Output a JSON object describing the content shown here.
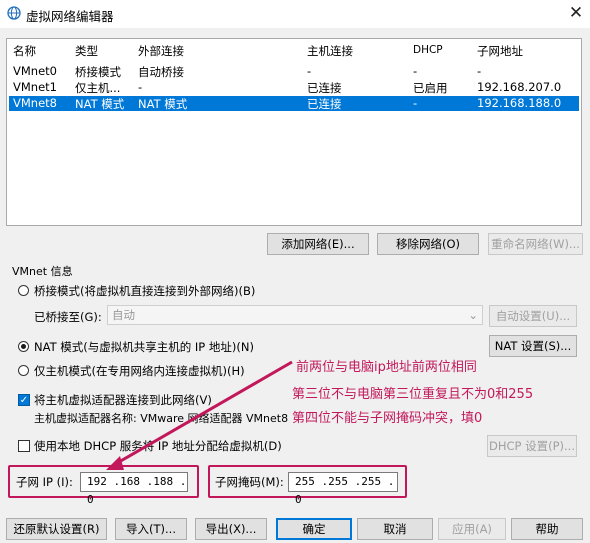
{
  "window": {
    "title": "虚拟网络编辑器",
    "icon": "network-globe-icon",
    "close_icon": "close-icon"
  },
  "table": {
    "headers": [
      "名称",
      "类型",
      "外部连接",
      "主机连接",
      "DHCP",
      "子网地址"
    ],
    "rows": [
      [
        "VMnet0",
        "桥接模式",
        "自动桥接",
        "-",
        "-",
        "-"
      ],
      [
        "VMnet1",
        "仅主机...",
        "-",
        "已连接",
        "已启用",
        "192.168.207.0"
      ],
      [
        "VMnet8",
        "NAT 模式",
        "NAT 模式",
        "已连接",
        "-",
        "192.168.188.0"
      ]
    ],
    "selected_row": 2
  },
  "table_buttons": {
    "add": "添加网络(E)...",
    "remove": "移除网络(O)",
    "rename": "重命名网络(W)..."
  },
  "vmnet_info": {
    "group_label": "VMnet 信息",
    "bridged_radio": "桥接模式(将虚拟机直接连接到外部网络)(B)",
    "bridged_to_label": "已桥接至(G):",
    "bridged_to_value": "自动",
    "auto_settings": "自动设置(U)...",
    "nat_radio": "NAT 模式(与虚拟机共享主机的 IP 地址)(N)",
    "nat_settings": "NAT 设置(S)...",
    "hostonly_radio": "仅主机模式(在专用网络内连接虚拟机)(H)",
    "connect_adapter": "将主机虚拟适配器连接到此网络(V)",
    "adapter_name": "主机虚拟适配器名称: VMware 网络适配器 VMnet8",
    "use_dhcp": "使用本地 DHCP 服务将 IP 地址分配给虚拟机(D)",
    "dhcp_settings": "DHCP 设置(P)...",
    "subnet_ip_label": "子网 IP (I):",
    "subnet_ip_value": "192 .168 .188 . 0",
    "subnet_mask_label": "子网掩码(M):",
    "subnet_mask_value": "255 .255 .255 . 0",
    "selected_mode": "nat",
    "connect_adapter_checked": true,
    "use_dhcp_checked": false
  },
  "annotations": {
    "line1": "前两位与电脑ip地址前两位相同",
    "line2": "第三位不与电脑第三位重复且不为0和255",
    "line3": "第四位不能与子网掩码冲突，填0",
    "color": "#c2185b"
  },
  "footer": {
    "restore": "还原默认设置(R)",
    "import": "导入(T)...",
    "export": "导出(X)...",
    "ok": "确定",
    "cancel": "取消",
    "apply": "应用(A)",
    "help": "帮助"
  },
  "colors": {
    "selection": "#0078d7",
    "annotation": "#c2185b"
  }
}
